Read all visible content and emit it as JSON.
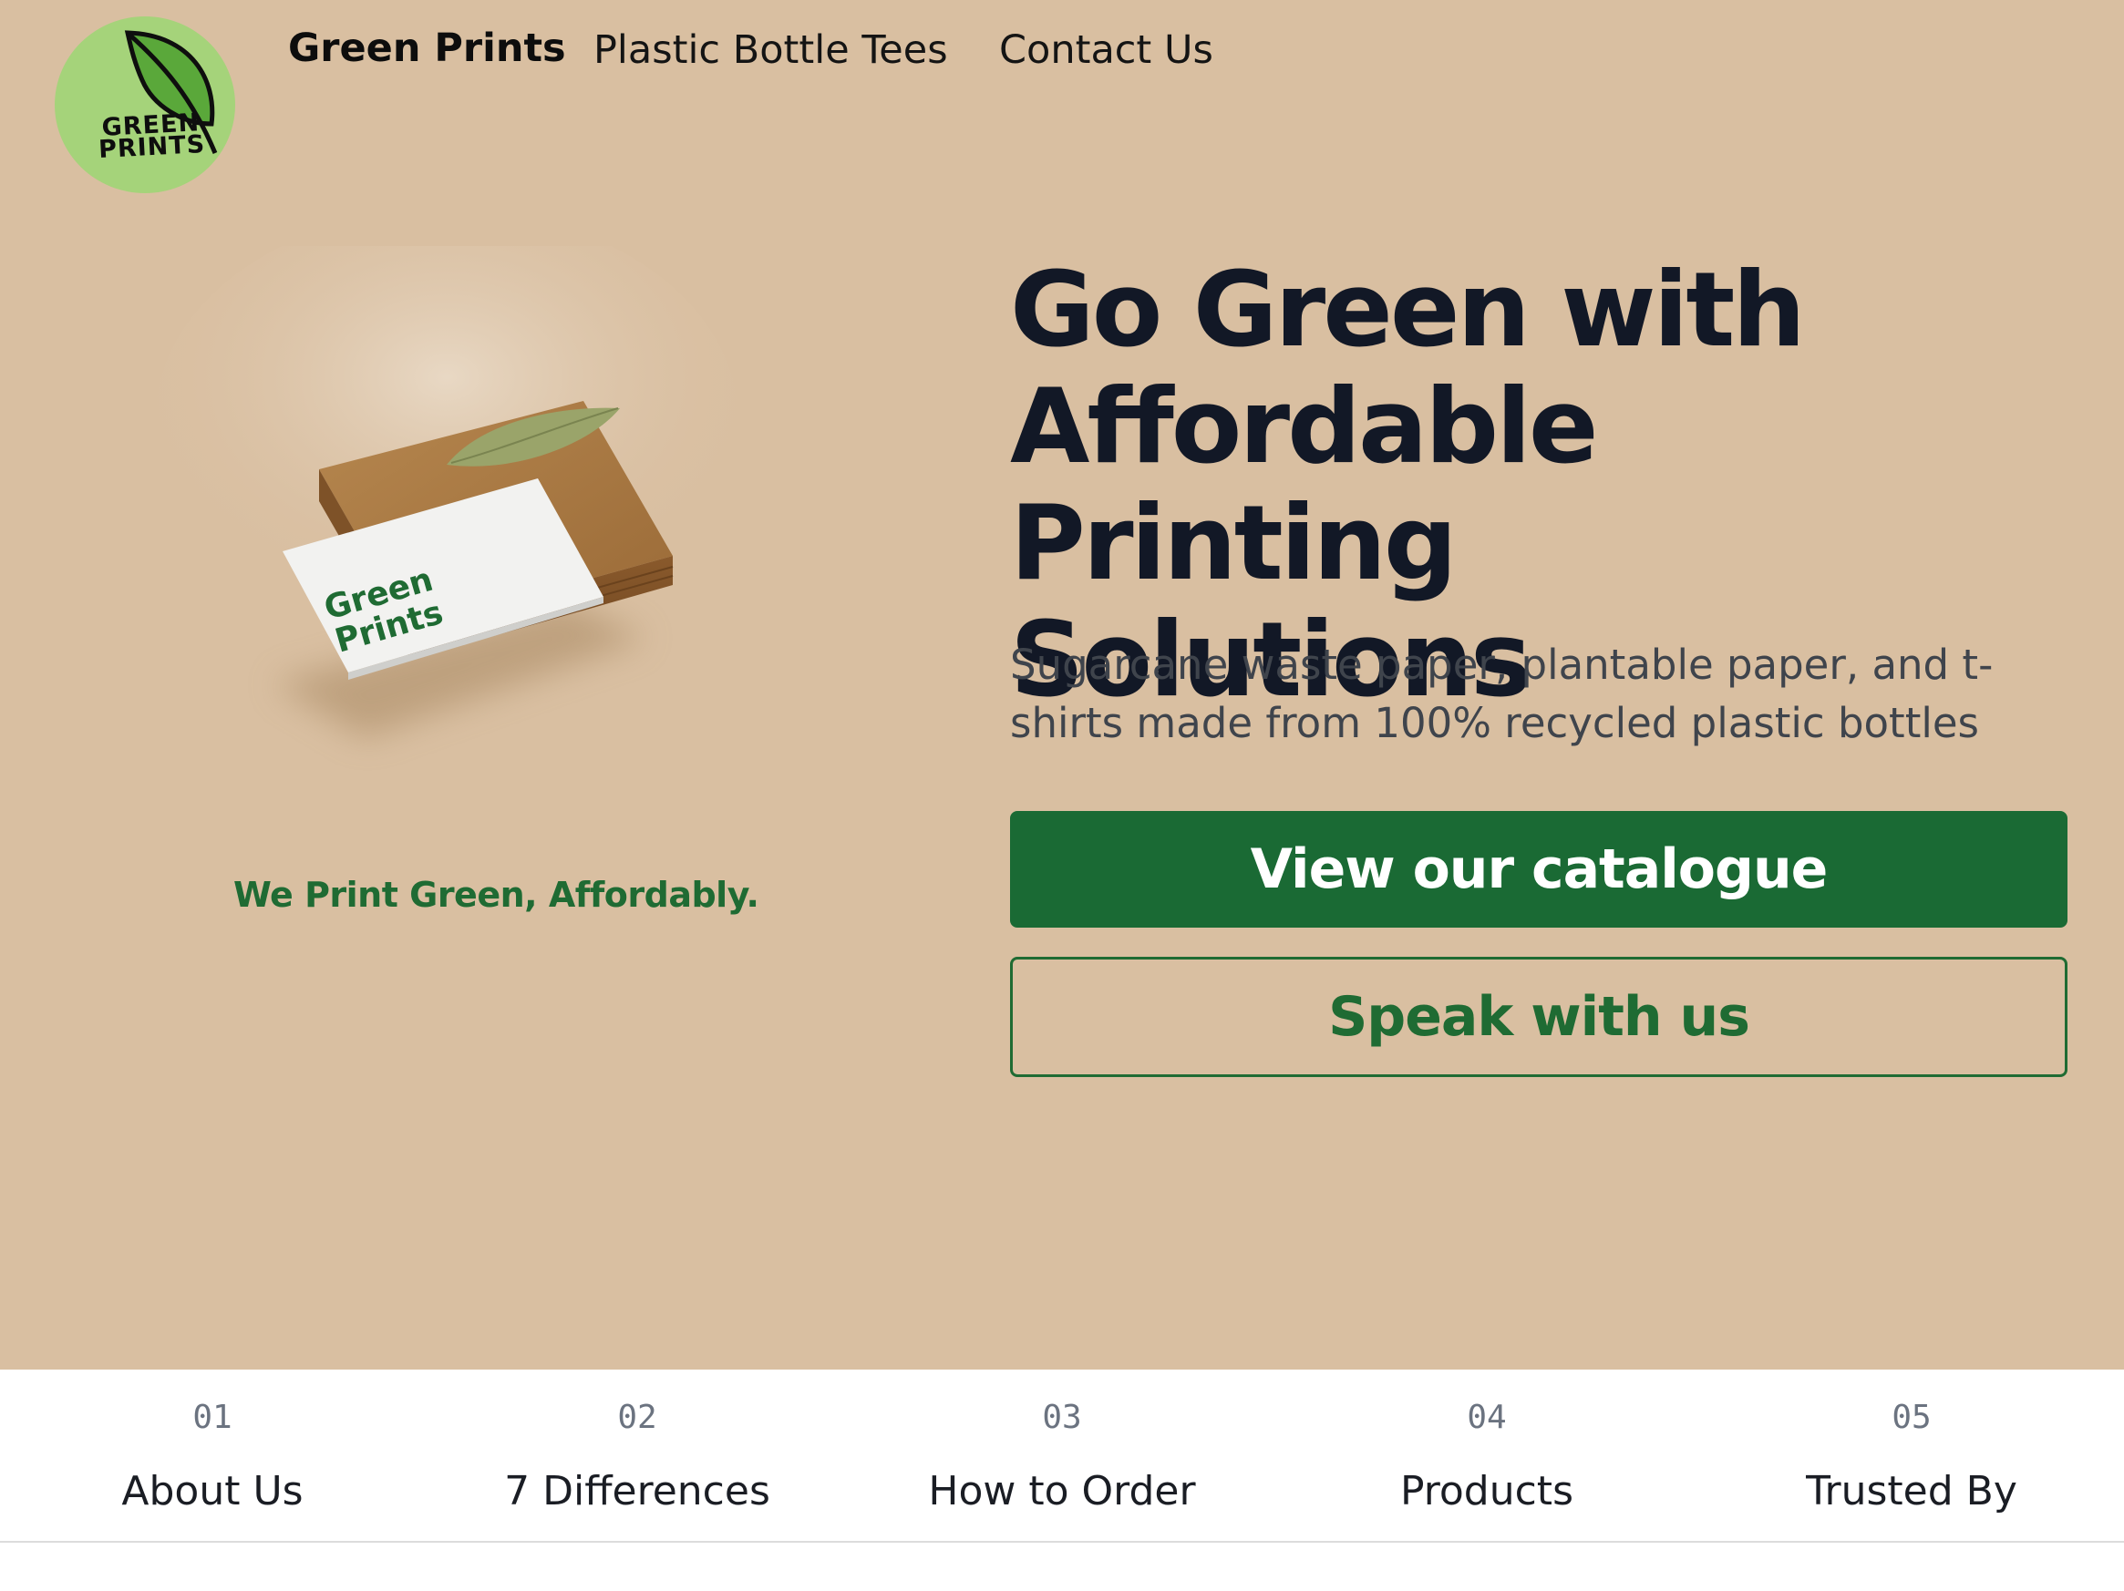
{
  "brand": {
    "logo_text_line1": "GREEN",
    "logo_text_line2": "PRINTS",
    "name": "Green Prints"
  },
  "nav": {
    "links": [
      {
        "label": "Plastic Bottle Tees"
      },
      {
        "label": "Contact Us"
      }
    ]
  },
  "hero": {
    "card_text_line1": "Green",
    "card_text_line2": "Prints",
    "tagline": "We Print Green, Affordably.",
    "headline_line1": "Go Green with",
    "headline_line2": "Affordable Printing",
    "headline_line3": "Solutions",
    "subheadline": "Sugarcane waste paper, plantable paper, and t-shirts made from 100% recycled plastic bottles",
    "primary_button": "View our catalogue",
    "secondary_button": "Speak with us"
  },
  "sections": [
    {
      "number": "01",
      "label": "About Us"
    },
    {
      "number": "02",
      "label": "7 Differences"
    },
    {
      "number": "03",
      "label": "How to Order"
    },
    {
      "number": "04",
      "label": "Products"
    },
    {
      "number": "05",
      "label": "Trusted By"
    }
  ],
  "colors": {
    "hero_background": "#d9bfa1",
    "brand_green": "#1a6a34",
    "logo_circle": "#a5d37a",
    "headline": "#121826"
  }
}
